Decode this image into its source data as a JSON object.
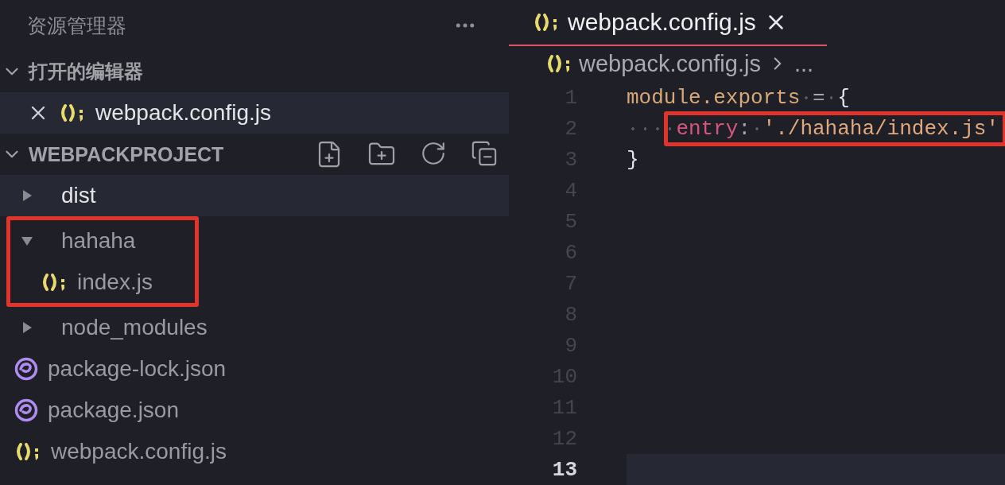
{
  "sidebar": {
    "title": "资源管理器",
    "sections": [
      {
        "label": "打开的编辑器",
        "expanded": true,
        "kind": "open_editors",
        "items": [
          {
            "name": "webpack.config.js",
            "kind": "js_file",
            "selected": true
          }
        ]
      },
      {
        "label": "WEBPACKPROJECT",
        "expanded": true,
        "kind": "project",
        "items": [
          {
            "name": "dist",
            "kind": "folder",
            "expanded": false,
            "selected": true
          },
          {
            "name": "hahaha",
            "kind": "folder",
            "expanded": true,
            "selected": false,
            "annotated": true,
            "children": [
              {
                "name": "index.js",
                "kind": "js_file",
                "selected": false
              }
            ]
          },
          {
            "name": "node_modules",
            "kind": "folder",
            "expanded": false,
            "selected": false
          },
          {
            "name": "package-lock.json",
            "kind": "json_file",
            "selected": false
          },
          {
            "name": "package.json",
            "kind": "json_file",
            "selected": false
          },
          {
            "name": "webpack.config.js",
            "kind": "js_file",
            "selected": false
          }
        ]
      }
    ]
  },
  "editor": {
    "tabs": [
      {
        "label": "webpack.config.js",
        "kind": "js_file",
        "selected": true
      }
    ],
    "breadcrumb": {
      "file": "webpack.config.js",
      "kind": "js_file",
      "rest": "..."
    },
    "lines": [
      {
        "number": "1",
        "current": false,
        "tokens": [
          {
            "kind": "property",
            "text": "module.exports"
          },
          {
            "kind": "space"
          },
          {
            "kind": "operator",
            "text": "="
          },
          {
            "kind": "space"
          },
          {
            "kind": "brace",
            "text": "{"
          }
        ]
      },
      {
        "number": "2",
        "current": false,
        "annotated": true,
        "indent_tokens": [
          {
            "kind": "space"
          },
          {
            "kind": "space"
          },
          {
            "kind": "space"
          },
          {
            "kind": "space"
          }
        ],
        "tokens": [
          {
            "kind": "key",
            "text": "entry"
          },
          {
            "kind": "operator",
            "text": ":"
          },
          {
            "kind": "space"
          },
          {
            "kind": "string",
            "text": "'./hahaha/index.js'"
          }
        ]
      },
      {
        "number": "3",
        "current": false,
        "tokens": [
          {
            "kind": "brace",
            "text": "}"
          }
        ]
      },
      {
        "number": "4",
        "current": false
      },
      {
        "number": "5",
        "current": false
      },
      {
        "number": "6",
        "current": false
      },
      {
        "number": "7",
        "current": false
      },
      {
        "number": "8",
        "current": false
      },
      {
        "number": "9",
        "current": false
      },
      {
        "number": "10",
        "current": false
      },
      {
        "number": "11",
        "current": false
      },
      {
        "number": "12",
        "current": false
      },
      {
        "number": "13",
        "current": true
      }
    ]
  }
}
